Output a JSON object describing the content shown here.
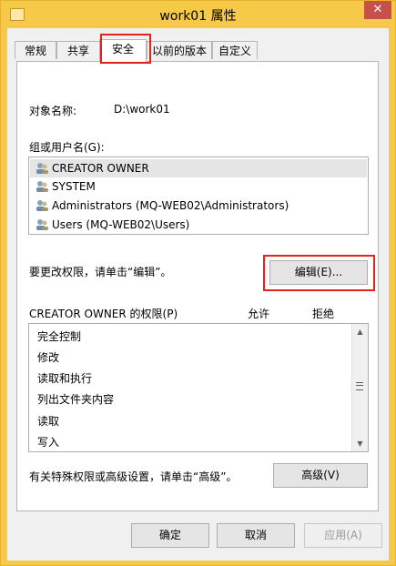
{
  "window": {
    "title": "work01 属性",
    "close_glyph": "✕",
    "title_icon": "folder-icon",
    "accent_color": "#f7c948"
  },
  "tabs": [
    {
      "label": "常规",
      "active": false
    },
    {
      "label": "共享",
      "active": false
    },
    {
      "label": "安全",
      "active": true
    },
    {
      "label": "以前的版本",
      "active": false
    },
    {
      "label": "自定义",
      "active": false
    }
  ],
  "security": {
    "object_name_label": "对象名称:",
    "object_name_value": "D:\\work01",
    "groups_label": "组或用户名(G):",
    "users": [
      {
        "name": "CREATOR OWNER",
        "icon": "user-icon",
        "selected": true
      },
      {
        "name": "SYSTEM",
        "icon": "user-group-icon",
        "selected": false
      },
      {
        "name": "Administrators (MQ-WEB02\\Administrators)",
        "icon": "user-group-icon",
        "selected": false
      },
      {
        "name": "Users (MQ-WEB02\\Users)",
        "icon": "user-group-icon",
        "selected": false
      }
    ],
    "change_hint": "要更改权限，请单击“编辑”。",
    "edit_button": "编辑(E)...",
    "permissions_label": "CREATOR OWNER 的权限(P)",
    "allow_header": "允许",
    "deny_header": "拒绝",
    "permissions": [
      "完全控制",
      "修改",
      "读取和执行",
      "列出文件夹内容",
      "读取",
      "写入"
    ],
    "advanced_hint": "有关特殊权限或高级设置，请单击“高级”。",
    "advanced_button": "高级(V)"
  },
  "footer": {
    "ok_button": "确定",
    "cancel_button": "取消",
    "apply_button": "应用(A)",
    "apply_disabled": true
  },
  "annotation_color": "#e2231a"
}
